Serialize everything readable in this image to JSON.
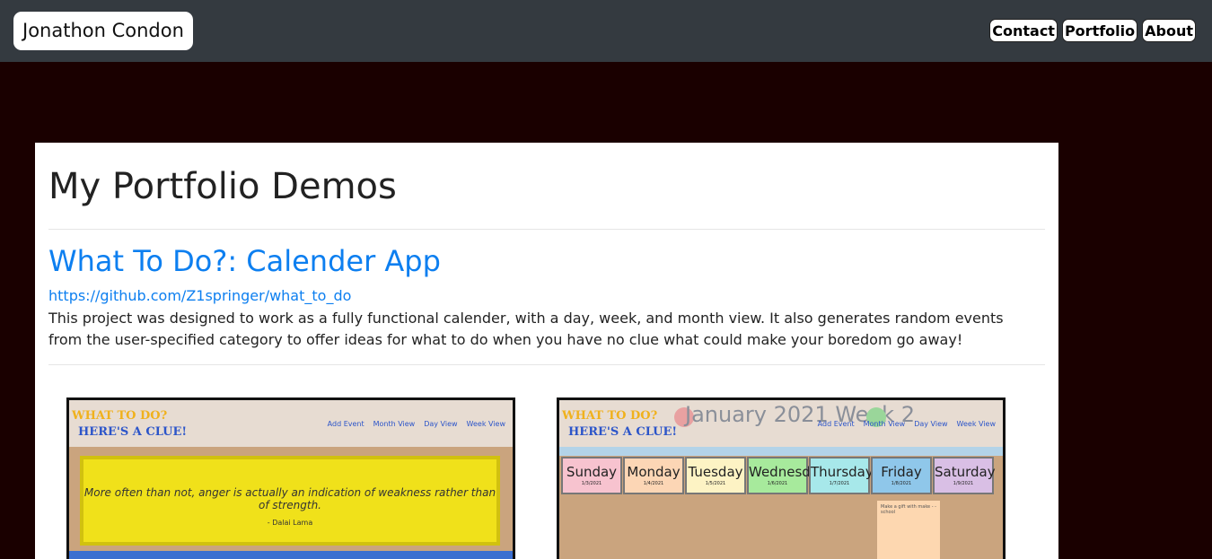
{
  "navbar": {
    "brand": "Jonathon Condon",
    "links": [
      "Contact",
      "Portfolio",
      "About"
    ]
  },
  "main": {
    "title": "My Portfolio Demos",
    "project": {
      "title": "What To Do?: Calender App",
      "link": "https://github.com/Z1springer/what_to_do",
      "description": "This project was designed to work as a fully functional calender, with a day, week, and month view. It also generates random events from the user-specified category to offer ideas for what to do when you have no clue what could make your boredom go away!"
    }
  },
  "screenshots": {
    "logo_line1": "WHAT TO DO?",
    "logo_line2": "HERE'S A CLUE!",
    "mini_nav": [
      "Add Event",
      "Month View",
      "Day View",
      "Week View"
    ],
    "quote": "More often than not, anger is actually an indication of weakness rather than of strength.",
    "quote_author": "- Dalai Lama",
    "week_title": "January 2021 Week 2",
    "days": [
      {
        "name": "Sunday",
        "date": "1/3/2021",
        "color": "#f7c3cf"
      },
      {
        "name": "Monday",
        "date": "1/4/2021",
        "color": "#fcd6b5"
      },
      {
        "name": "Tuesday",
        "date": "1/5/2021",
        "color": "#fdf3c4"
      },
      {
        "name": "Wednesday",
        "date": "1/6/2021",
        "color": "#a7ea9c"
      },
      {
        "name": "Thursday",
        "date": "1/7/2021",
        "color": "#a7e8ea"
      },
      {
        "name": "Friday",
        "date": "1/8/2021",
        "color": "#8fc7ea"
      },
      {
        "name": "Saturday",
        "date": "1/9/2021",
        "color": "#d9bfe5"
      }
    ],
    "note": "Make a gift with make - - school"
  },
  "colors": {
    "page_bg": "#1a0000",
    "navbar_bg": "#343a40",
    "link": "#0d7ff0"
  }
}
